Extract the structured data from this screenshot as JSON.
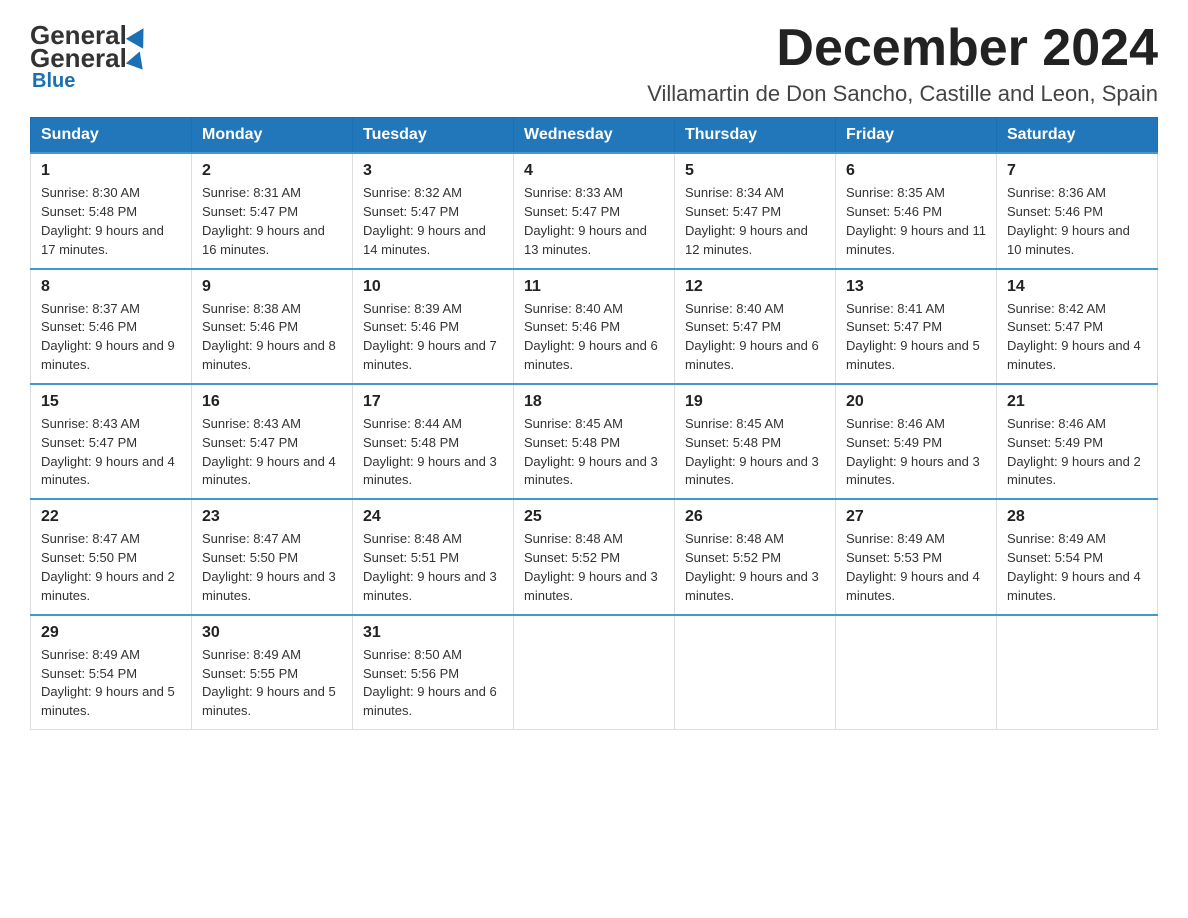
{
  "header": {
    "title": "December 2024",
    "location": "Villamartin de Don Sancho, Castille and Leon, Spain",
    "logo_general": "General",
    "logo_blue": "Blue"
  },
  "days_of_week": [
    "Sunday",
    "Monday",
    "Tuesday",
    "Wednesday",
    "Thursday",
    "Friday",
    "Saturday"
  ],
  "weeks": [
    [
      {
        "day": "1",
        "sunrise": "Sunrise: 8:30 AM",
        "sunset": "Sunset: 5:48 PM",
        "daylight": "Daylight: 9 hours and 17 minutes."
      },
      {
        "day": "2",
        "sunrise": "Sunrise: 8:31 AM",
        "sunset": "Sunset: 5:47 PM",
        "daylight": "Daylight: 9 hours and 16 minutes."
      },
      {
        "day": "3",
        "sunrise": "Sunrise: 8:32 AM",
        "sunset": "Sunset: 5:47 PM",
        "daylight": "Daylight: 9 hours and 14 minutes."
      },
      {
        "day": "4",
        "sunrise": "Sunrise: 8:33 AM",
        "sunset": "Sunset: 5:47 PM",
        "daylight": "Daylight: 9 hours and 13 minutes."
      },
      {
        "day": "5",
        "sunrise": "Sunrise: 8:34 AM",
        "sunset": "Sunset: 5:47 PM",
        "daylight": "Daylight: 9 hours and 12 minutes."
      },
      {
        "day": "6",
        "sunrise": "Sunrise: 8:35 AM",
        "sunset": "Sunset: 5:46 PM",
        "daylight": "Daylight: 9 hours and 11 minutes."
      },
      {
        "day": "7",
        "sunrise": "Sunrise: 8:36 AM",
        "sunset": "Sunset: 5:46 PM",
        "daylight": "Daylight: 9 hours and 10 minutes."
      }
    ],
    [
      {
        "day": "8",
        "sunrise": "Sunrise: 8:37 AM",
        "sunset": "Sunset: 5:46 PM",
        "daylight": "Daylight: 9 hours and 9 minutes."
      },
      {
        "day": "9",
        "sunrise": "Sunrise: 8:38 AM",
        "sunset": "Sunset: 5:46 PM",
        "daylight": "Daylight: 9 hours and 8 minutes."
      },
      {
        "day": "10",
        "sunrise": "Sunrise: 8:39 AM",
        "sunset": "Sunset: 5:46 PM",
        "daylight": "Daylight: 9 hours and 7 minutes."
      },
      {
        "day": "11",
        "sunrise": "Sunrise: 8:40 AM",
        "sunset": "Sunset: 5:46 PM",
        "daylight": "Daylight: 9 hours and 6 minutes."
      },
      {
        "day": "12",
        "sunrise": "Sunrise: 8:40 AM",
        "sunset": "Sunset: 5:47 PM",
        "daylight": "Daylight: 9 hours and 6 minutes."
      },
      {
        "day": "13",
        "sunrise": "Sunrise: 8:41 AM",
        "sunset": "Sunset: 5:47 PM",
        "daylight": "Daylight: 9 hours and 5 minutes."
      },
      {
        "day": "14",
        "sunrise": "Sunrise: 8:42 AM",
        "sunset": "Sunset: 5:47 PM",
        "daylight": "Daylight: 9 hours and 4 minutes."
      }
    ],
    [
      {
        "day": "15",
        "sunrise": "Sunrise: 8:43 AM",
        "sunset": "Sunset: 5:47 PM",
        "daylight": "Daylight: 9 hours and 4 minutes."
      },
      {
        "day": "16",
        "sunrise": "Sunrise: 8:43 AM",
        "sunset": "Sunset: 5:47 PM",
        "daylight": "Daylight: 9 hours and 4 minutes."
      },
      {
        "day": "17",
        "sunrise": "Sunrise: 8:44 AM",
        "sunset": "Sunset: 5:48 PM",
        "daylight": "Daylight: 9 hours and 3 minutes."
      },
      {
        "day": "18",
        "sunrise": "Sunrise: 8:45 AM",
        "sunset": "Sunset: 5:48 PM",
        "daylight": "Daylight: 9 hours and 3 minutes."
      },
      {
        "day": "19",
        "sunrise": "Sunrise: 8:45 AM",
        "sunset": "Sunset: 5:48 PM",
        "daylight": "Daylight: 9 hours and 3 minutes."
      },
      {
        "day": "20",
        "sunrise": "Sunrise: 8:46 AM",
        "sunset": "Sunset: 5:49 PM",
        "daylight": "Daylight: 9 hours and 3 minutes."
      },
      {
        "day": "21",
        "sunrise": "Sunrise: 8:46 AM",
        "sunset": "Sunset: 5:49 PM",
        "daylight": "Daylight: 9 hours and 2 minutes."
      }
    ],
    [
      {
        "day": "22",
        "sunrise": "Sunrise: 8:47 AM",
        "sunset": "Sunset: 5:50 PM",
        "daylight": "Daylight: 9 hours and 2 minutes."
      },
      {
        "day": "23",
        "sunrise": "Sunrise: 8:47 AM",
        "sunset": "Sunset: 5:50 PM",
        "daylight": "Daylight: 9 hours and 3 minutes."
      },
      {
        "day": "24",
        "sunrise": "Sunrise: 8:48 AM",
        "sunset": "Sunset: 5:51 PM",
        "daylight": "Daylight: 9 hours and 3 minutes."
      },
      {
        "day": "25",
        "sunrise": "Sunrise: 8:48 AM",
        "sunset": "Sunset: 5:52 PM",
        "daylight": "Daylight: 9 hours and 3 minutes."
      },
      {
        "day": "26",
        "sunrise": "Sunrise: 8:48 AM",
        "sunset": "Sunset: 5:52 PM",
        "daylight": "Daylight: 9 hours and 3 minutes."
      },
      {
        "day": "27",
        "sunrise": "Sunrise: 8:49 AM",
        "sunset": "Sunset: 5:53 PM",
        "daylight": "Daylight: 9 hours and 4 minutes."
      },
      {
        "day": "28",
        "sunrise": "Sunrise: 8:49 AM",
        "sunset": "Sunset: 5:54 PM",
        "daylight": "Daylight: 9 hours and 4 minutes."
      }
    ],
    [
      {
        "day": "29",
        "sunrise": "Sunrise: 8:49 AM",
        "sunset": "Sunset: 5:54 PM",
        "daylight": "Daylight: 9 hours and 5 minutes."
      },
      {
        "day": "30",
        "sunrise": "Sunrise: 8:49 AM",
        "sunset": "Sunset: 5:55 PM",
        "daylight": "Daylight: 9 hours and 5 minutes."
      },
      {
        "day": "31",
        "sunrise": "Sunrise: 8:50 AM",
        "sunset": "Sunset: 5:56 PM",
        "daylight": "Daylight: 9 hours and 6 minutes."
      },
      null,
      null,
      null,
      null
    ]
  ]
}
